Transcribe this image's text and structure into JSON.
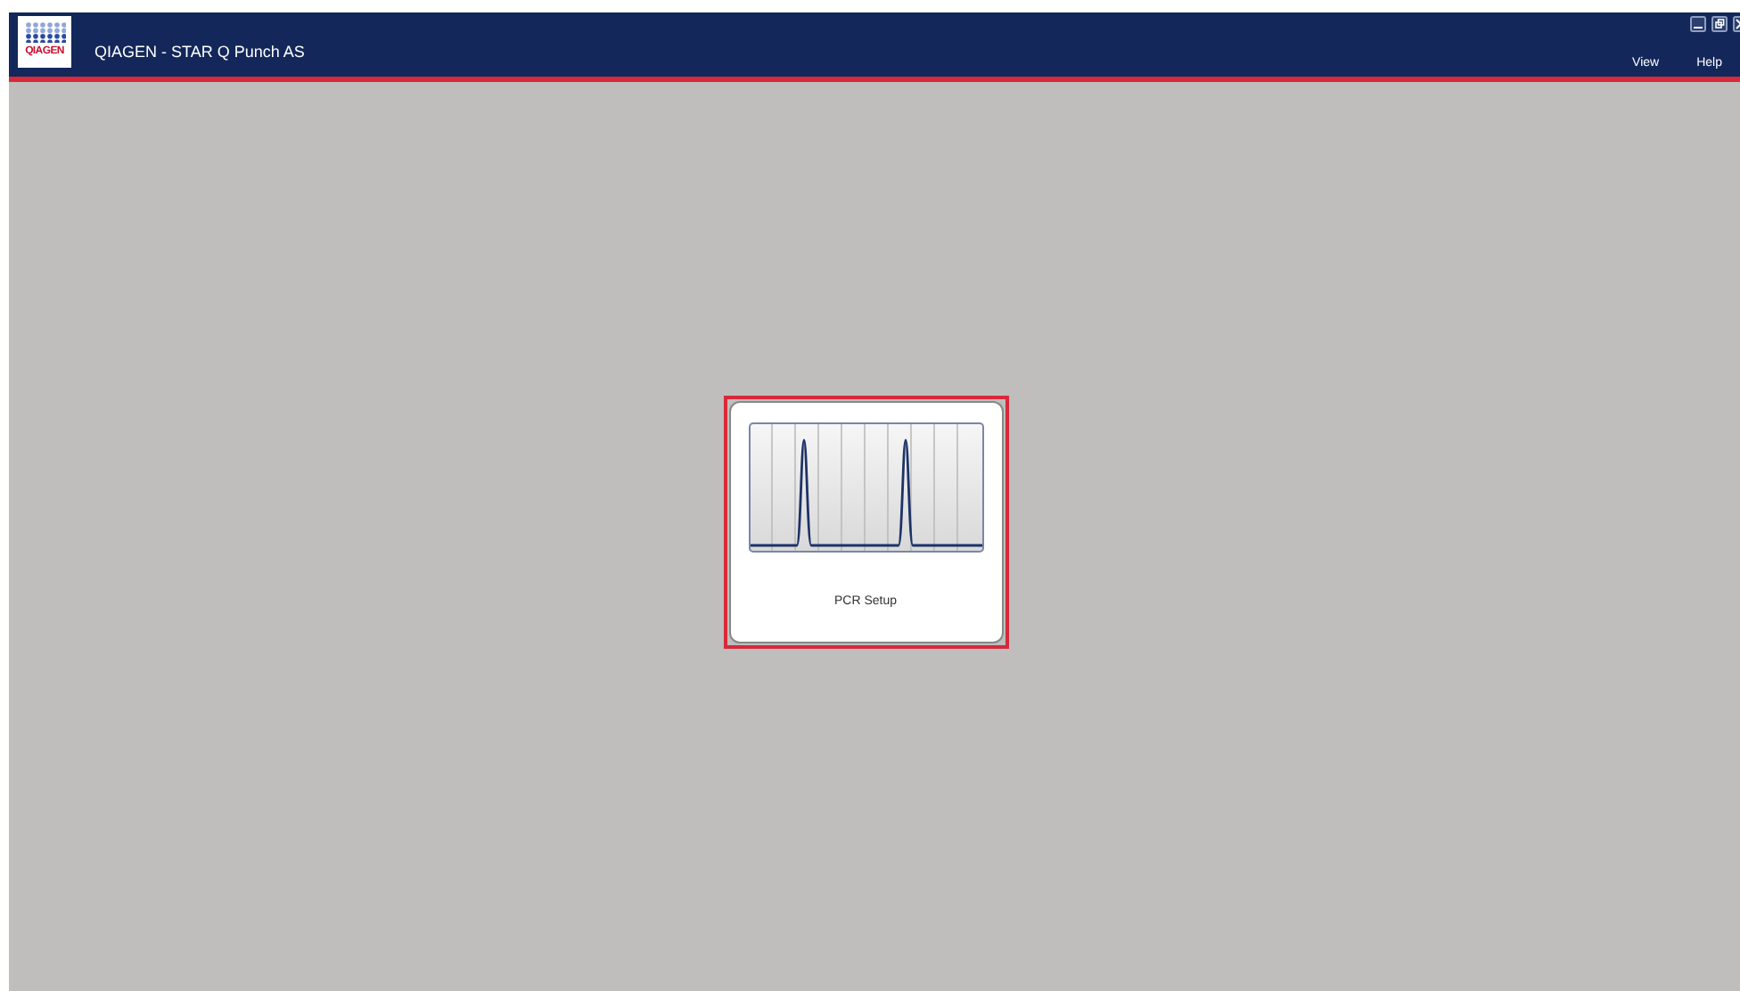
{
  "window": {
    "logo_text": "QIAGEN",
    "title": "QIAGEN - STAR Q Punch AS"
  },
  "menu": [
    "View",
    "Help"
  ],
  "tiles": [
    {
      "label": "PCR Setup",
      "selected": true
    }
  ]
}
